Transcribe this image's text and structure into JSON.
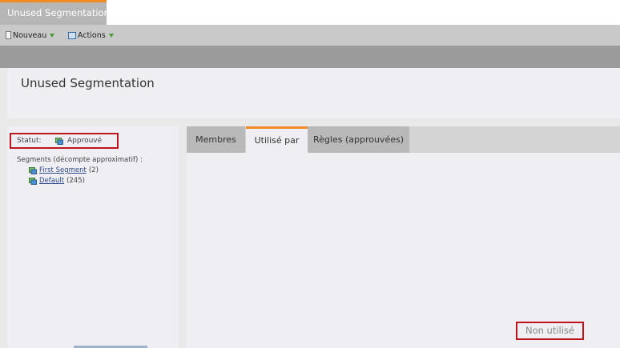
{
  "window": {
    "tab_title": "Unused Segmentation"
  },
  "toolbar": {
    "new_label": "Nouveau",
    "actions_label": "Actions"
  },
  "page": {
    "title": "Unused Segmentation"
  },
  "left_panel": {
    "status_label": "Statut:",
    "status_value": "Approuvé",
    "segments_label": "Segments (décompte approximatif) :",
    "segments": [
      {
        "name": "First Segment",
        "count": "(2)"
      },
      {
        "name": "Default",
        "count": "(245)"
      }
    ]
  },
  "tabs": [
    {
      "label": "Membres",
      "active": false
    },
    {
      "label": "Utilisé par",
      "active": true
    },
    {
      "label": "Règles (approuvées)",
      "active": false
    }
  ],
  "content": {
    "usage_status": "Non utilisé"
  },
  "colors": {
    "accent": "#f08a24",
    "highlight_border": "#c0141d",
    "link": "#2f4a8a",
    "status_icon": "#3a8a3a"
  },
  "icons": {
    "status": "approved-icon",
    "segment": "segment-icon",
    "new": "new-document-icon",
    "actions": "actions-icon",
    "dropdown": "dropdown-triangle-icon"
  }
}
